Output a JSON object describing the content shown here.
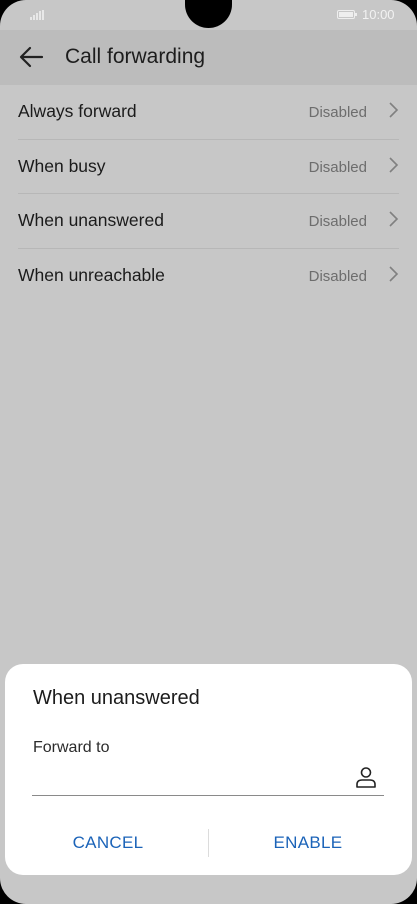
{
  "status_bar": {
    "time": "10:00"
  },
  "toolbar": {
    "title": "Call forwarding"
  },
  "forwarding_items": [
    {
      "label": "Always forward",
      "status": "Disabled"
    },
    {
      "label": "When busy",
      "status": "Disabled"
    },
    {
      "label": "When unanswered",
      "status": "Disabled"
    },
    {
      "label": "When unreachable",
      "status": "Disabled"
    }
  ],
  "dialog": {
    "title": "When unanswered",
    "field_label": "Forward to",
    "field_value": "",
    "cancel_label": "CANCEL",
    "enable_label": "ENABLE"
  },
  "colors": {
    "accent": "#1b63b8",
    "dimmed_background": "#c7c7c7",
    "toolbar": "#bcbcbc"
  }
}
